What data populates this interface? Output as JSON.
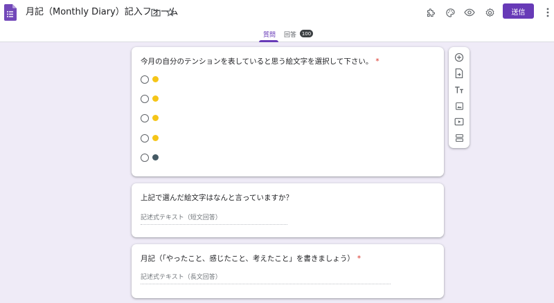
{
  "header": {
    "title": "月記（Monthly Diary）記入フォーム",
    "send_label": "送信",
    "icons": [
      "forms-logo-icon",
      "folder-icon",
      "star-icon",
      "addon-puzzle-icon",
      "palette-icon",
      "preview-eye-icon",
      "settings-gear-icon",
      "more-vert-icon"
    ]
  },
  "tabs": {
    "questions": "質問",
    "responses": "回答",
    "responses_count": "100"
  },
  "questions": [
    {
      "title": "今月の自分のテンションを表していると思う絵文字を選択して下さい。",
      "required": "*",
      "type": "multiple-choice",
      "options": [
        {
          "emoji": "🙂",
          "color": "#f5c518"
        },
        {
          "emoji": "😄",
          "color": "#f5c518"
        },
        {
          "emoji": "😐",
          "color": "#f5c518"
        },
        {
          "emoji": "😟",
          "color": "#f5c518"
        },
        {
          "emoji": "👽",
          "color": "#455a64"
        }
      ]
    },
    {
      "title": "上記で選んだ絵文字はなんと言っていますか？",
      "required": "",
      "type": "short-answer",
      "placeholder": "記述式テキスト（短文回答）"
    },
    {
      "title": "月記（「やったこと、感じたこと、考えたこと」を書きましょう）",
      "required": "*",
      "type": "paragraph",
      "placeholder": "記述式テキスト（長文回答）"
    }
  ],
  "toolbar": [
    "add-question-icon",
    "import-questions-icon",
    "add-title-icon",
    "add-image-icon",
    "add-video-icon",
    "add-section-icon"
  ],
  "colors": {
    "accent": "#673ab7",
    "background": "#efebf7",
    "required": "#d93025"
  }
}
